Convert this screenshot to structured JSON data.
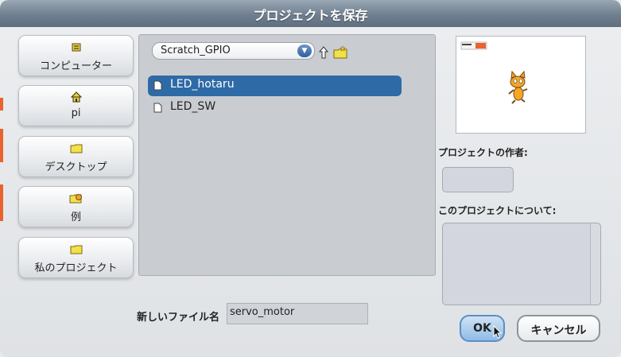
{
  "dialog": {
    "title": "プロジェクトを保存"
  },
  "sidebar": {
    "items": [
      {
        "label": "コンピューター",
        "icon": "computer-icon"
      },
      {
        "label": "pi",
        "icon": "home-icon"
      },
      {
        "label": "デスクトップ",
        "icon": "folder-icon"
      },
      {
        "label": "例",
        "icon": "examples-icon"
      },
      {
        "label": "私のプロジェクト",
        "icon": "folder-icon"
      }
    ]
  },
  "browser": {
    "location": "Scratch_GPIO",
    "files": [
      {
        "name": "LED_hotaru",
        "selected": true
      },
      {
        "name": "LED_SW",
        "selected": false
      }
    ]
  },
  "info": {
    "author_label": "プロジェクトの作者:",
    "author_value": "",
    "about_label": "このプロジェクトについて:",
    "about_value": ""
  },
  "filename": {
    "label": "新しいファイル名",
    "value": "servo_motor"
  },
  "buttons": {
    "ok": "OK",
    "cancel": "キャンセル"
  },
  "colors": {
    "title_bar": "#6f7f8f",
    "selection": "#2e6aa6",
    "ok_button": "#8fbce5"
  }
}
